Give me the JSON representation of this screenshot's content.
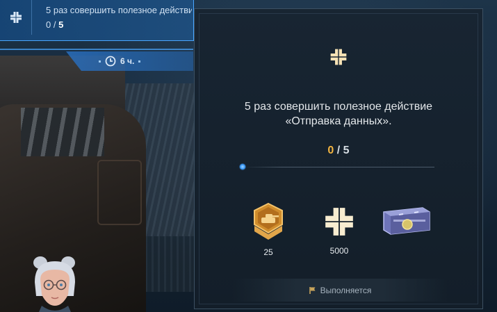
{
  "task": {
    "title": "5 раз совершить полезное действие «Отправка данных».",
    "progress_current": "0",
    "progress_total": "5",
    "timer": "6 ч."
  },
  "panel": {
    "description_line1": "5 раз совершить полезное действие",
    "description_line2": "«Отправка данных».",
    "progress_current": "0",
    "progress_separator": "/",
    "progress_total": "5",
    "rewards": [
      {
        "icon": "tank-badge-icon",
        "value": "25"
      },
      {
        "icon": "exp-arrows-icon",
        "value": "5000"
      },
      {
        "icon": "container-chest-icon",
        "value": ""
      }
    ],
    "status": "Выполняется"
  },
  "colors": {
    "accent_gold": "#f2b441",
    "banner_blue": "#1e5082",
    "panel_bg": "#172430"
  }
}
